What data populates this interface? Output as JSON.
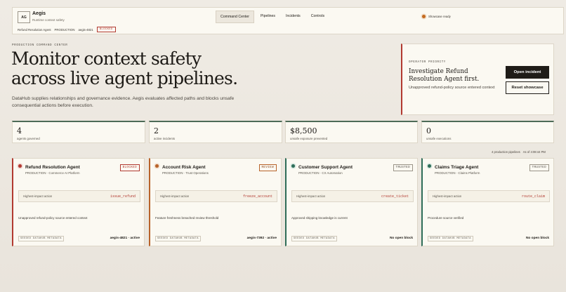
{
  "header": {
    "logo": "AG",
    "brand_name": "Aegis",
    "brand_subtitle": "Runtime context safety",
    "meta_agent": "Refund Resolution Agent",
    "meta_env": "PRODUCTION",
    "meta_id": "aegis-4821",
    "meta_badge": "BLOCKED",
    "nav": [
      "Command Center",
      "Pipelines",
      "Incidents",
      "Controls"
    ],
    "status": "Showcase ready"
  },
  "hero": {
    "eyebrow": "PRODUCTION COMMAND CENTER",
    "headline_line1": "Monitor context safety",
    "headline_line2": "across live agent pipelines.",
    "lede": "DataHub supplies relationships and governance evidence. Aegis evaluates affected paths and blocks unsafe consequential actions before execution."
  },
  "priority": {
    "eyebrow": "OPERATOR PRIORITY",
    "title": "Investigate Refund Resolution Agent first.",
    "description": "Unapproved refund-policy source entered context",
    "primary_button": "Open incident",
    "secondary_button": "Reset showcase"
  },
  "stats": [
    {
      "value": "4",
      "label": "agents governed"
    },
    {
      "value": "2",
      "label": "active incidents"
    },
    {
      "value": "$8,500",
      "label": "unsafe exposure prevented"
    },
    {
      "value": "0",
      "label": "unsafe executions"
    }
  ],
  "pipelines_caption": {
    "count": "4 production pipelines",
    "time": "As of 4:08:44 PM"
  },
  "agents": [
    {
      "name": "Refund Resolution Agent",
      "sub": "PRODUCTION · Commerce AI Platform",
      "badge": "BLOCKED",
      "action_label": "Highest-impact action",
      "action": "issue_refund",
      "note": "Unapproved refund-policy source entered context",
      "tag": "SEEDED DATAHUB METADATA",
      "footer": "aegis-4821 · active"
    },
    {
      "name": "Account Risk Agent",
      "sub": "PRODUCTION · Trust Operations",
      "badge": "REVIEW",
      "action_label": "Highest-impact action",
      "action": "freeze_account",
      "note": "Feature freshness breached review threshold",
      "tag": "SEEDED DATAHUB METADATA",
      "footer": "aegis-7392 · active"
    },
    {
      "name": "Customer Support Agent",
      "sub": "PRODUCTION · CX Automation",
      "badge": "TRUSTED",
      "action_label": "Highest-impact action",
      "action": "create_ticket",
      "note": "Approved shipping knowledge is current",
      "tag": "SEEDED DATAHUB METADATA",
      "footer": "No open block"
    },
    {
      "name": "Claims Triage Agent",
      "sub": "PRODUCTION · Claims Platform",
      "badge": "TRUSTED",
      "action_label": "Highest-impact action",
      "action": "route_claim",
      "note": "Procedure source verified",
      "tag": "SEEDED DATAHUB METADATA",
      "footer": "No open block"
    }
  ],
  "colors": {
    "blocked": "#b23a31",
    "review": "#b8632a",
    "trusted": "#2f6d58",
    "ink": "#1f1c18"
  }
}
